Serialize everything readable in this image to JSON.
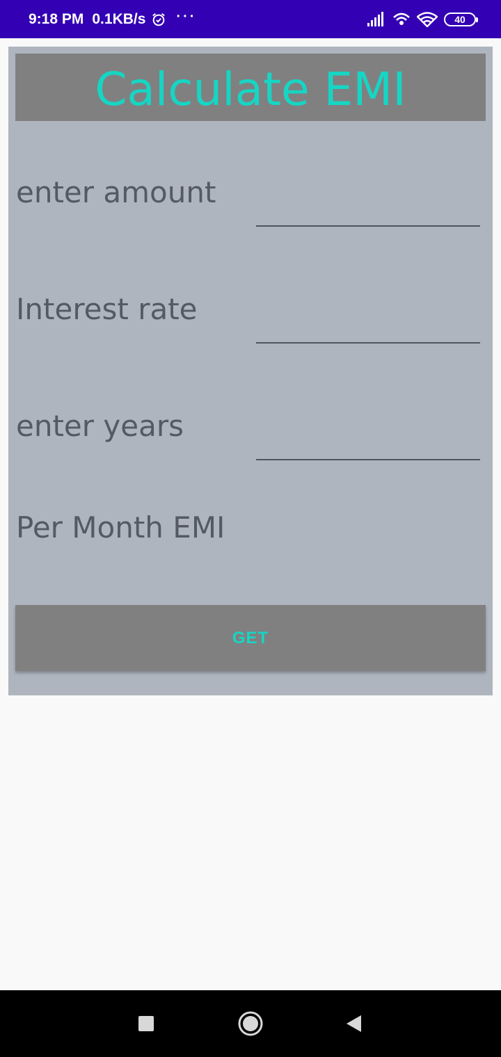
{
  "status_bar": {
    "time": "9:18 PM",
    "speed": "0.1KB/s",
    "more": "···",
    "battery": "40",
    "icons": [
      "alarm-icon",
      "signal-icon",
      "wifi-hotspot-icon",
      "wifi-icon",
      "battery-icon"
    ]
  },
  "app": {
    "title": "Calculate EMI",
    "fields": [
      {
        "label": "enter amount",
        "value": "",
        "placeholder": ""
      },
      {
        "label": "Interest rate",
        "value": "",
        "placeholder": ""
      },
      {
        "label": "enter years",
        "value": "",
        "placeholder": ""
      }
    ],
    "result_label": "Per Month EMI",
    "button_label": "GET"
  },
  "colors": {
    "status_bar": "#3300b4",
    "card_bg": "#aeb5bf",
    "header_bg": "#808080",
    "accent": "#17d5c4",
    "label_text": "#545a63"
  },
  "nav_bar": {
    "icons": [
      "recents-square-icon",
      "home-circle-icon",
      "back-triangle-icon"
    ]
  }
}
